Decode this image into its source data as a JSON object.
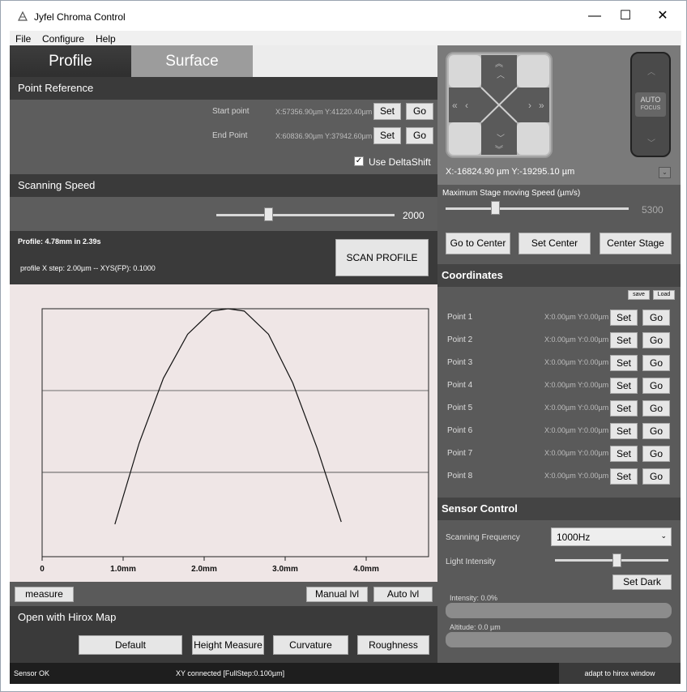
{
  "window": {
    "title": "Jyfel Chroma Control",
    "minimize": "—",
    "maximize": "☐",
    "close": "✕"
  },
  "menu": [
    "File",
    "Configure",
    "Help"
  ],
  "tabs": {
    "profile": "Profile",
    "surface": "Surface"
  },
  "point_reference": {
    "header": "Point Reference",
    "start_label": "Start point",
    "start_value": "X:57356.90µm Y:41220.40µm",
    "end_label": "End Point",
    "end_value": "X:60836.90µm Y:37942.60µm",
    "set": "Set",
    "go": "Go",
    "use_deltashift": "Use DeltaShift",
    "use_deltashift_checked": true
  },
  "scanning_speed": {
    "header": "Scanning Speed",
    "value": "2000",
    "level": 0.28
  },
  "profile_info": {
    "summary": "Profile: 4.78mm in 2.39s",
    "step": "profile X step: 2.00µm -- XYS(FP): 0.1000",
    "scan_button": "SCAN PROFILE"
  },
  "chart_data": {
    "type": "line",
    "x_ticks": [
      "0",
      "1.0mm",
      "2.0mm",
      "3.0mm",
      "4.0mm"
    ],
    "xlim": [
      0,
      4.78
    ],
    "grid_lines_y_fraction": [
      0.67,
      0.34
    ],
    "series": [
      {
        "x": [
          0.9,
          1.2,
          1.5,
          1.8,
          2.1,
          2.3,
          2.5,
          2.8,
          3.1,
          3.4,
          3.7
        ],
        "y": [
          0.07,
          0.42,
          0.7,
          0.89,
          0.99,
          1.0,
          0.99,
          0.89,
          0.68,
          0.4,
          0.08
        ]
      }
    ]
  },
  "measure_bar": {
    "measure": "measure",
    "manual": "Manual lvl",
    "auto": "Auto lvl"
  },
  "hirox": {
    "header": "Open with Hirox Map",
    "buttons": [
      "Default",
      "Height Measure",
      "Curvature",
      "Roughness"
    ]
  },
  "stage": {
    "position": "X:-16824.90 µm  Y:-19295.10 µm",
    "autofocus_1": "AUTO",
    "autofocus_2": "FOCUS",
    "speed_label": "Maximum Stage moving Speed (µm/s)",
    "speed_value": "5300",
    "speed_level": 0.26,
    "go_to_center": "Go to Center",
    "set_center": "Set Center",
    "center_stage": "Center Stage"
  },
  "coordinates": {
    "header": "Coordinates",
    "save": "save",
    "load": "Load",
    "points": [
      {
        "label": "Point 1",
        "value": "X:0.00µm Y:0.00µm"
      },
      {
        "label": "Point 2",
        "value": "X:0.00µm Y:0.00µm"
      },
      {
        "label": "Point 3",
        "value": "X:0.00µm Y:0.00µm"
      },
      {
        "label": "Point 4",
        "value": "X:0.00µm Y:0.00µm"
      },
      {
        "label": "Point 5",
        "value": "X:0.00µm Y:0.00µm"
      },
      {
        "label": "Point 6",
        "value": "X:0.00µm Y:0.00µm"
      },
      {
        "label": "Point 7",
        "value": "X:0.00µm Y:0.00µm"
      },
      {
        "label": "Point 8",
        "value": "X:0.00µm Y:0.00µm"
      }
    ],
    "set": "Set",
    "go": "Go"
  },
  "sensor_control": {
    "header": "Sensor Control",
    "freq_label": "Scanning Frequency",
    "freq_value": "1000Hz",
    "light_label": "Light Intensity",
    "light_level": 0.55,
    "set_dark": "Set Dark",
    "intensity": "Intensity: 0.0%",
    "altitude": "Altitude: 0.0 µm"
  },
  "status": {
    "sensor": "Sensor OK",
    "xy": "XY connected [FullStep:0.100µm]",
    "adapt": "adapt to hirox window"
  }
}
